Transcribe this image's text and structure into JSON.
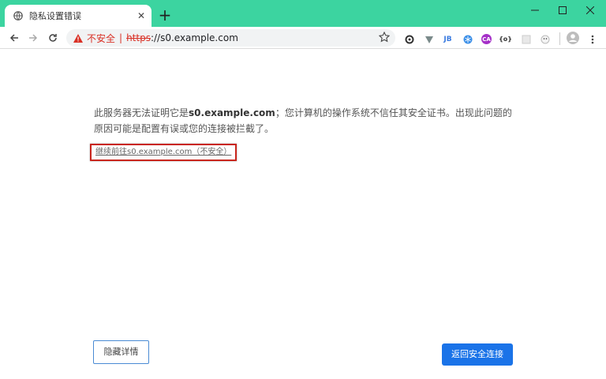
{
  "tab": {
    "title": "隐私设置错误",
    "close": "✕",
    "new_tab": "+"
  },
  "window": {
    "minimize": "—",
    "maximize": "☐",
    "close": "✕"
  },
  "address_bar": {
    "security_label": "不安全",
    "separator": "|",
    "scheme": "https",
    "rest": "://s0.example.com"
  },
  "extensions": {
    "jb_label": "JB",
    "ca_label": "CA",
    "json_label": "{o}"
  },
  "colors": {
    "titlebar": "#3cd4a0",
    "warning": "#d93025",
    "primary_button": "#1a73e8"
  },
  "message": {
    "part1": "此服务器无法证明它是",
    "host": "s0.example.com",
    "part2": "；您计算机的操作系统不信任其安全证书。出现此问题的原因可能是配置有误或您的连接被拦截了。"
  },
  "proceed_link": "继续前往s0.example.com（不安全）",
  "buttons": {
    "hide_details": "隐藏详情",
    "back_to_safety": "返回安全连接"
  }
}
